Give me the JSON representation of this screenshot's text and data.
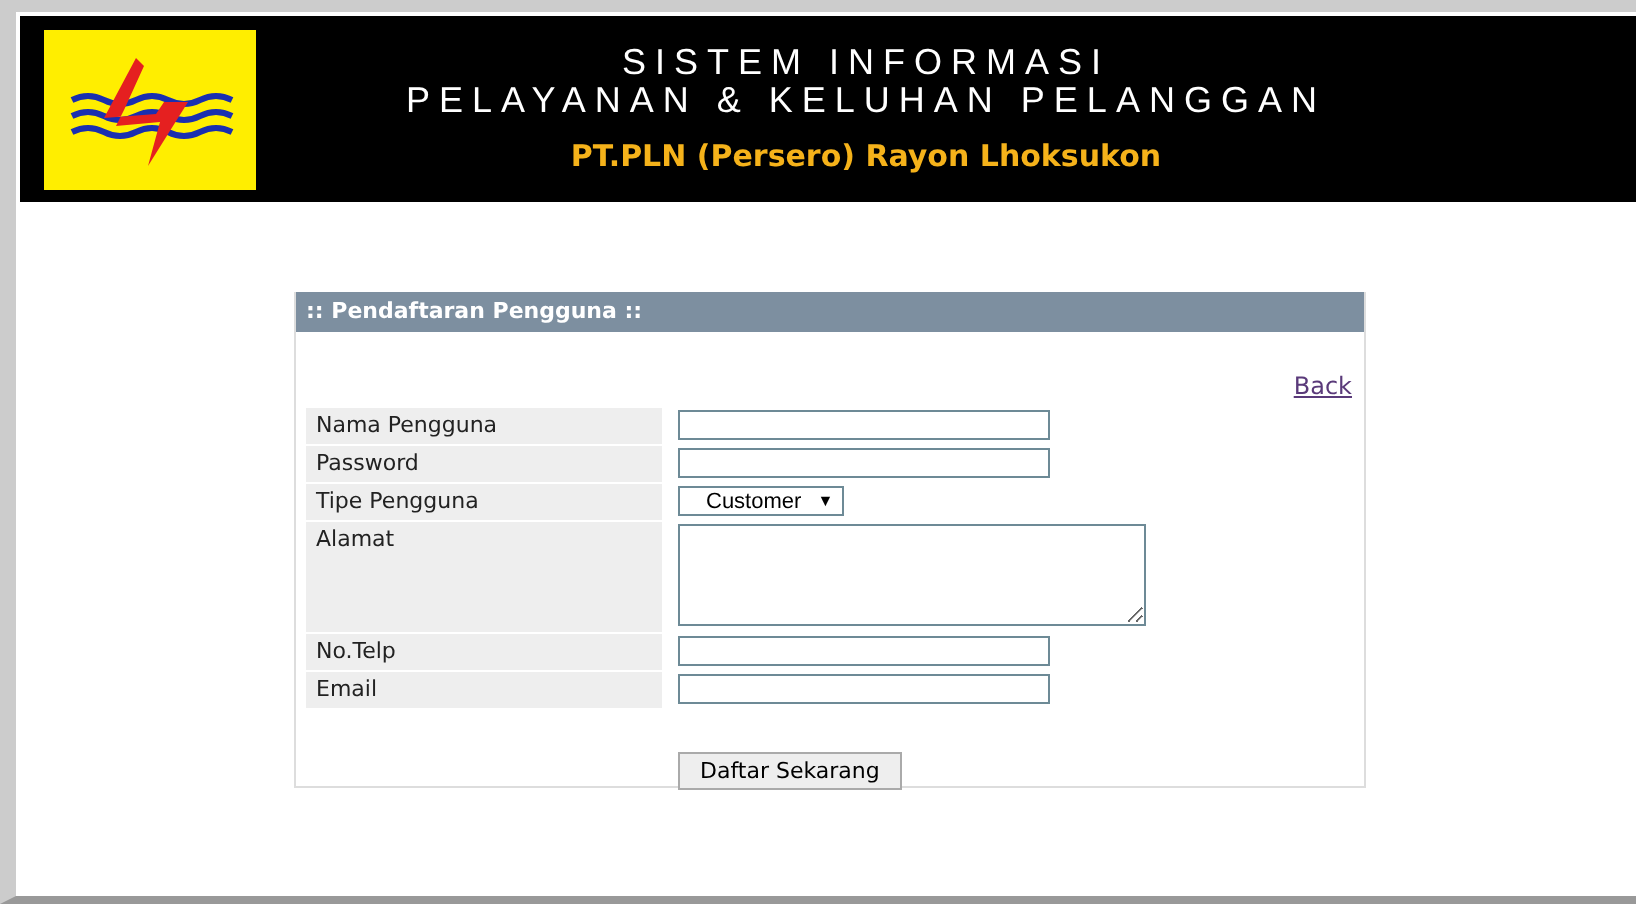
{
  "header": {
    "title_line_1": "SISTEM INFORMASI",
    "title_line_2": "PELAYANAN & KELUHAN PELANGGAN",
    "subtitle": "PT.PLN  (Persero) Rayon Lhoksukon"
  },
  "form": {
    "title": ":: Pendaftaran Pengguna ::",
    "back_link": "Back",
    "fields": [
      {
        "label": "Nama Pengguna",
        "kind": "text"
      },
      {
        "label": "Password",
        "kind": "text"
      },
      {
        "label": "Tipe Pengguna",
        "kind": "select",
        "value": "Customer",
        "arrow": "▼"
      },
      {
        "label": "Alamat",
        "kind": "textarea"
      },
      {
        "label": "No.Telp",
        "kind": "text"
      },
      {
        "label": "Email",
        "kind": "text"
      }
    ],
    "submit": "Daftar Sekarang"
  }
}
